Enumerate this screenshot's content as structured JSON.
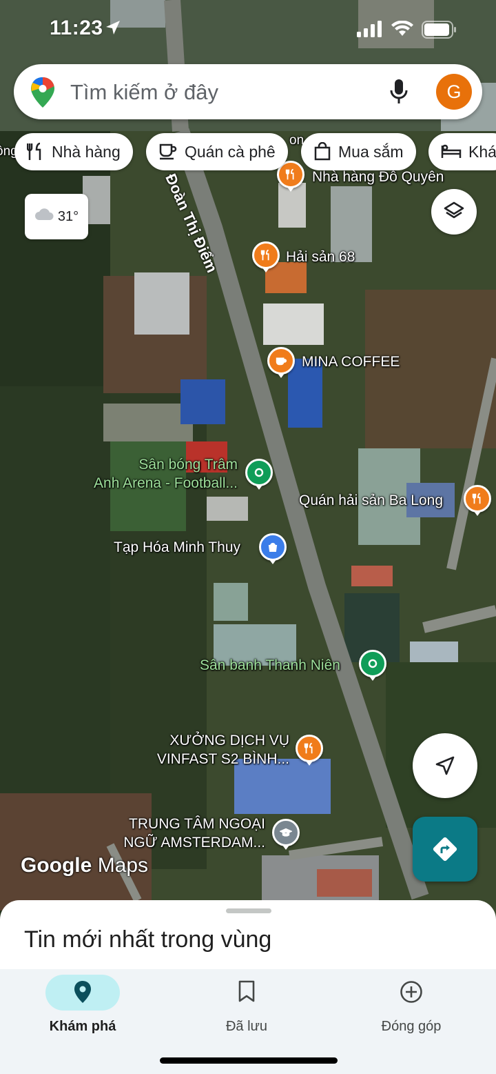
{
  "status_bar": {
    "time": "11:23"
  },
  "search": {
    "placeholder": "Tìm kiếm ở đây",
    "avatar_letter": "G"
  },
  "chips": [
    {
      "label": "Nhà hàng",
      "icon": "fork-knife-icon"
    },
    {
      "label": "Quán cà phê",
      "icon": "coffee-cup-icon"
    },
    {
      "label": "Mua sắm",
      "icon": "shopping-bag-icon"
    },
    {
      "label": "Khác",
      "icon": "bed-icon"
    }
  ],
  "weather": {
    "temperature": "31°",
    "icon": "cloud-icon"
  },
  "map": {
    "road_name": "Đoàn Thị Điểm",
    "pois": [
      {
        "label": "Nhà hàng Đỗ Quyên",
        "type": "restaurant"
      },
      {
        "label": "Hải sản 68",
        "type": "restaurant"
      },
      {
        "label": "MINA COFFEE",
        "type": "cafe"
      },
      {
        "label_lines": [
          "Sân bóng Trâm",
          "Anh Arena -  Football..."
        ],
        "type": "sports"
      },
      {
        "label": "Quán hải sản Ba Long",
        "type": "restaurant"
      },
      {
        "label": "Tạp Hóa Minh Thuy",
        "type": "shop"
      },
      {
        "label": "Sân banh Thanh Niên",
        "type": "sports"
      },
      {
        "label_lines": [
          "XƯỞNG DỊCH VỤ",
          "VINFAST S2 BÌNH..."
        ],
        "type": "restaurant"
      },
      {
        "label_lines": [
          "TRUNG TÂM NGOẠI",
          "NGỮ AMSTERDAM..."
        ],
        "type": "school"
      }
    ],
    "partial_edge_text": [
      "ông",
      "on"
    ]
  },
  "attribution": {
    "google": "Google",
    "maps": "Maps"
  },
  "sheet": {
    "title": "Tin mới nhất trong vùng"
  },
  "bottom_nav": [
    {
      "label": "Khám phá",
      "icon": "location-pin-icon",
      "active": true
    },
    {
      "label": "Đã lưu",
      "icon": "bookmark-icon",
      "active": false
    },
    {
      "label": "Đóng góp",
      "icon": "add-circle-icon",
      "active": false
    }
  ],
  "colors": {
    "accent_teal": "#0b7a86",
    "avatar": "#e8710a",
    "active_pill": "#bfeff3"
  }
}
